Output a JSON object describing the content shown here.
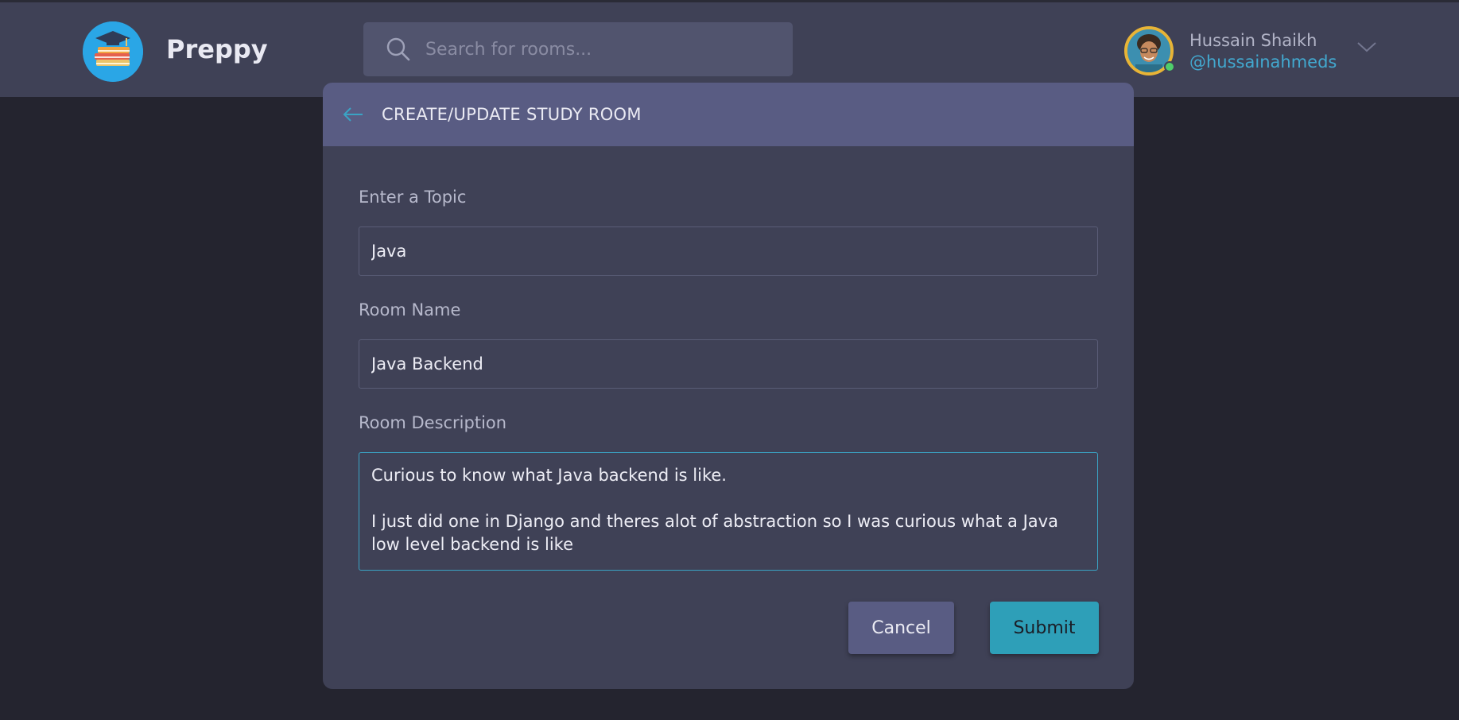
{
  "app": {
    "brand": "Preppy"
  },
  "search": {
    "placeholder": "Search for rooms..."
  },
  "user": {
    "name": "Hussain Shaikh",
    "handle": "@hussainahmeds"
  },
  "form": {
    "title": "CREATE/UPDATE STUDY ROOM",
    "topic_label": "Enter a Topic",
    "topic_value": "Java",
    "room_name_label": "Room Name",
    "room_name_value": "Java Backend",
    "description_label": "Room Description",
    "description_value": "Curious to know what Java backend is like.\n\nI just did one in Django and theres alot of abstraction so I was curious what a Java low level backend is like",
    "cancel_label": "Cancel",
    "submit_label": "Submit"
  },
  "colors": {
    "accent": "#2e9fb8",
    "header_bg": "#3f4156",
    "card_head": "#595c83",
    "online": "#4fce6b"
  }
}
